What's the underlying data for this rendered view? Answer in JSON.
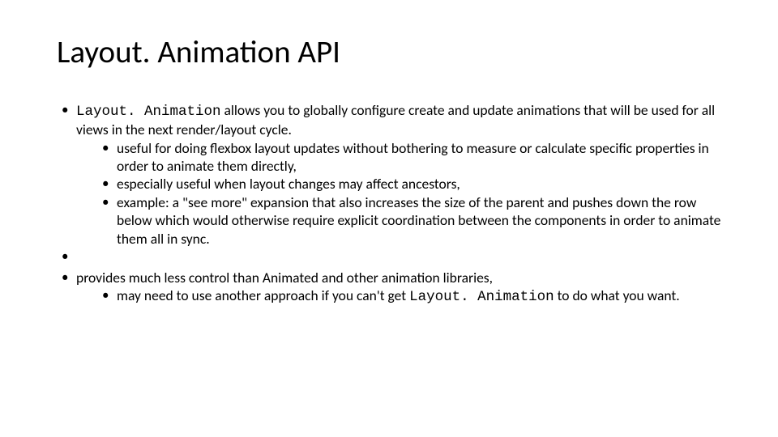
{
  "title": "Layout. Animation API",
  "bullets": {
    "b1": {
      "code": "Layout. Animation",
      "rest": " allows you to globally configure create and update animations that will be used for all views in the next render/layout cycle.",
      "sub1": "useful for doing flexbox layout updates without bothering to measure or calculate specific properties in order to animate them directly,",
      "sub2": "especially useful when layout changes may affect ancestors,",
      "sub3": " example: a \"see more\" expansion that also increases the size of the parent and pushes down the row below which would otherwise require explicit coordination between the components in order to animate them all in sync."
    },
    "b2": {
      "text": "provides much less control than Animated and other animation libraries,",
      "sub1_a": "may need to use another approach if you can't get ",
      "sub1_code": "Layout. Animation",
      "sub1_b": " to do what you want."
    }
  }
}
